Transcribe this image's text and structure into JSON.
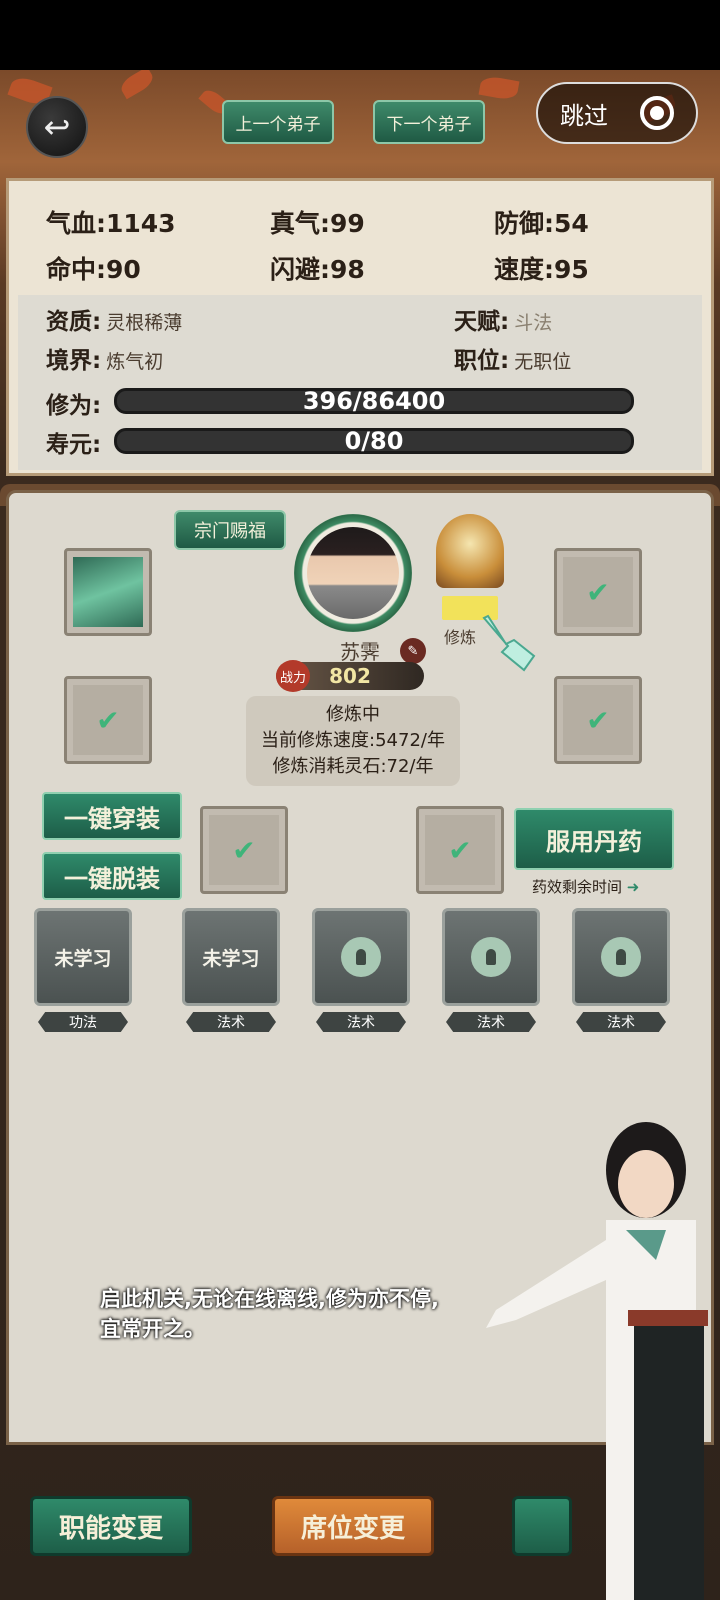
{
  "top": {
    "prev_label": "上一个弟子",
    "next_label": "下一个弟子",
    "skip_label": "跳过"
  },
  "stats": {
    "qixue": "气血:1143",
    "zhenqi": "真气:99",
    "fangyu": "防御:54",
    "mingzhong": "命中:90",
    "shanbi": "闪避:98",
    "sudu": "速度:95"
  },
  "info": {
    "zizhi_label": "资质:",
    "zizhi_value": "灵根稀薄",
    "tianfu_label": "天赋:",
    "tianfu_value": "斗法",
    "jingjie_label": "境界:",
    "jingjie_value": "炼气初",
    "zhiwei_label": "职位:",
    "zhiwei_value": "无职位",
    "xiuwei_label": "修为:",
    "xiuwei_value": "396/86400",
    "xiuwei_progress": 0.0046,
    "shouyuan_label": "寿元:",
    "shouyuan_value": "0/80",
    "shouyuan_progress": 0.0
  },
  "character": {
    "blessing_label": "宗门赐福",
    "name": "苏霁",
    "power_icon_text": "战力",
    "power": "802",
    "train_label": "修炼",
    "train_status": "修炼中",
    "train_speed": "当前修炼速度:5472/年",
    "train_cost": "修炼消耗灵石:72/年"
  },
  "actions": {
    "equip_all": "一键穿装",
    "unequip_all": "一键脱装",
    "take_pill": "服用丹药",
    "pill_remaining": "药效剩余时间"
  },
  "skills": [
    {
      "text": "未学习",
      "tag": "功法",
      "locked": false
    },
    {
      "text": "未学习",
      "tag": "法术",
      "locked": false
    },
    {
      "text": "",
      "tag": "法术",
      "locked": true
    },
    {
      "text": "",
      "tag": "法术",
      "locked": true
    },
    {
      "text": "",
      "tag": "法术",
      "locked": true
    }
  ],
  "dialog": {
    "line1": "启此机关,无论在线离线,修为亦不停,",
    "line2": "宜常开之。"
  },
  "bottom": {
    "role_change": "职能变更",
    "seat_change": "席位变更"
  },
  "colors": {
    "accent_green": "#2f8a6a",
    "accent_orange": "#d8823a",
    "check_green": "#3fb47a"
  }
}
